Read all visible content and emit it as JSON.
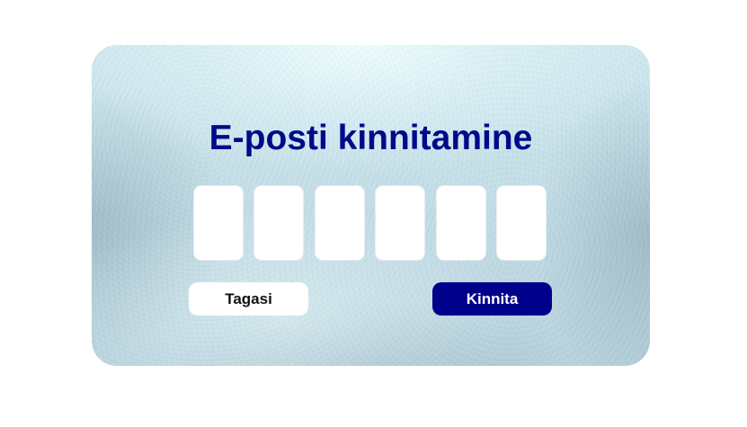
{
  "dialog": {
    "title": "E-posti kinnitamine",
    "code_length": 6,
    "code_values": [
      "",
      "",
      "",
      "",
      "",
      ""
    ],
    "back_label": "Tagasi",
    "confirm_label": "Kinnita"
  },
  "colors": {
    "title": "#000a8a",
    "confirm_button_bg": "#00008b",
    "confirm_button_text": "#ffffff",
    "back_button_bg": "#ffffff",
    "back_button_text": "#111111",
    "code_box_bg": "#ffffff"
  }
}
